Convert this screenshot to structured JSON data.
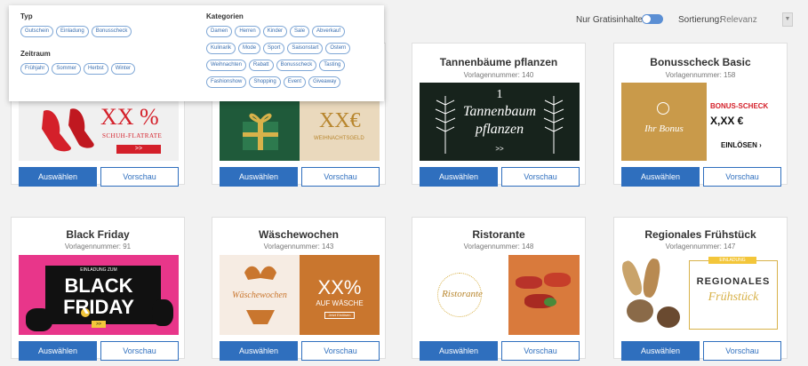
{
  "topbar": {
    "gratis_label": "Nur Gratisinhalte:",
    "sort_label": "Sortierung:",
    "sort_value": "Relevanz"
  },
  "filters": {
    "typ_heading": "Typ",
    "typ": [
      "Gutschein",
      "Einladung",
      "Bonusscheck"
    ],
    "zeitraum_heading": "Zeitraum",
    "zeitraum": [
      "Frühjahr",
      "Sommer",
      "Herbst",
      "Winter"
    ],
    "kategorien_heading": "Kategorien",
    "kategorien_row1": [
      "Damen",
      "Herren",
      "Kinder",
      "Sale",
      "Abverkauf"
    ],
    "kategorien_row2": [
      "Kulinarik",
      "Mode",
      "Sport",
      "Saisonstart",
      "Ostern"
    ],
    "kategorien_row3": [
      "Weihnachten",
      "Rabatt",
      "Bonusscheck",
      "Tasting"
    ],
    "kategorien_row4": [
      "Fashionshow",
      "Shopping",
      "Event",
      "Giveaway"
    ]
  },
  "buttons": {
    "select": "Auswählen",
    "preview": "Vorschau"
  },
  "cards_row1": [
    {
      "title": "",
      "sub": "",
      "art": {
        "big": "XX %",
        "small": "SCHUH-FLATRATE",
        "arrow": ">>"
      }
    },
    {
      "title": "",
      "sub": "",
      "art": {
        "big": "XX€",
        "small": "WEIHNACHTSGELD"
      }
    },
    {
      "title": "Tannenbäume pflanzen",
      "sub": "Vorlagennummer: 140",
      "art": {
        "num": "1",
        "line1": "Tannenbaum",
        "line2": "pflanzen",
        "arrow": ">>"
      }
    },
    {
      "title": "Bonusscheck Basic",
      "sub": "Vorlagennummer: 158",
      "art": {
        "script": "Ihr Bonus",
        "label": "BONUS-SCHECK",
        "amount": "X,XX €",
        "redeem": "EINLÖSEN ›"
      }
    }
  ],
  "cards_row2": [
    {
      "title": "Black Friday",
      "sub": "Vorlagennummer: 91",
      "art": {
        "top": "EINLADUNG ZUM",
        "line1": "BLACK",
        "line2": "FRIDAY",
        "arrow": ">>"
      }
    },
    {
      "title": "Wäschewochen",
      "sub": "Vorlagennummer: 143",
      "art": {
        "script": "Wäschewochen",
        "big": "XX%",
        "small": "AUF WÄSCHE",
        "tiny": "Jetzt Einlösen"
      }
    },
    {
      "title": "Ristorante",
      "sub": "Vorlagennummer: 148",
      "art": {
        "script": "Ristorante"
      }
    },
    {
      "title": "Regionales Frühstück",
      "sub": "Vorlagennummer: 147",
      "art": {
        "top": "EINLADUNG",
        "line1": "REGIONALES",
        "script": "Frühstück"
      }
    }
  ],
  "colors": {
    "primary": "#2f6fbe",
    "red": "#e8403a",
    "green": "#1f5a3a",
    "gold": "#c99a4a",
    "pink": "#e8368a",
    "orange": "#c9762e"
  }
}
